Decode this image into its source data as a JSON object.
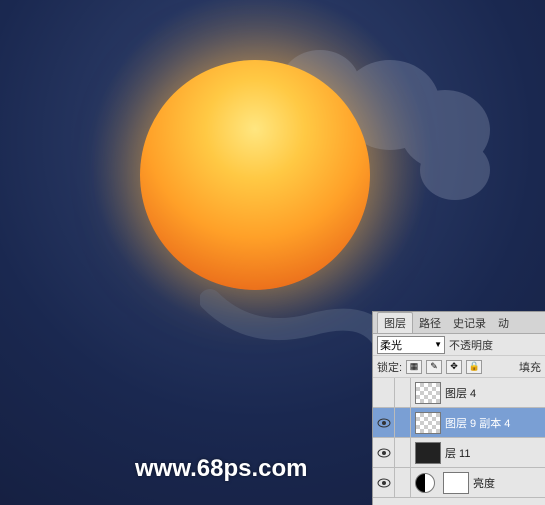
{
  "canvas": {
    "watermark": "www.68ps.com"
  },
  "panel": {
    "tabs": {
      "layers": "图层",
      "paths": "路径",
      "history": "史记录",
      "actions": "动"
    },
    "blend_mode": "柔光",
    "opacity_label": "不透明度",
    "lock_label": "锁定:",
    "fill_label": "填充",
    "lock_icons": {
      "transparency": "▦",
      "paint": "✎",
      "position": "✥",
      "all": "🔒"
    },
    "layers": [
      {
        "visible": false,
        "name": "图层 4",
        "thumb": "checker",
        "selected": false
      },
      {
        "visible": true,
        "name": "图层 9 副本 4",
        "thumb": "checker",
        "selected": true
      },
      {
        "visible": true,
        "name": "层 11",
        "thumb": "dark",
        "selected": false
      },
      {
        "visible": true,
        "name": "亮度",
        "thumb": "adjustment",
        "selected": false
      }
    ]
  }
}
